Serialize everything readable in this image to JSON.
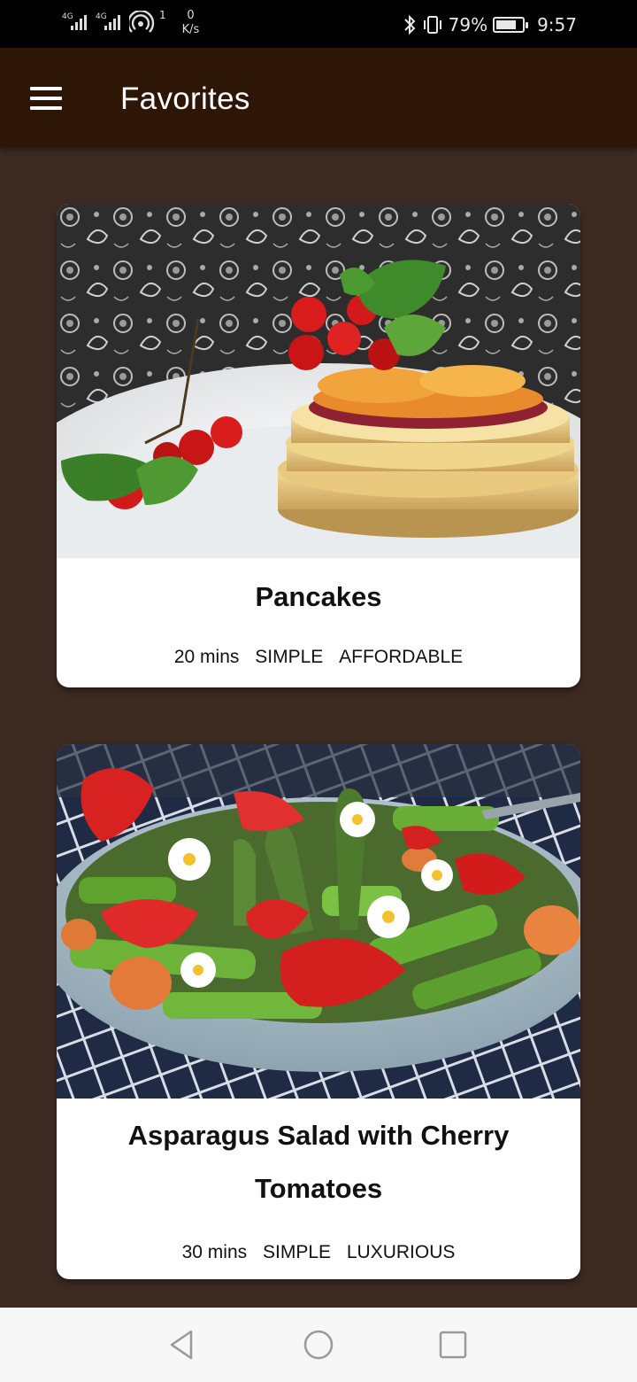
{
  "status_bar": {
    "network1": "4G",
    "network2": "4G",
    "wifi_sup": "1",
    "speed_value": "0",
    "speed_unit": "K/s",
    "battery_percent": "79%",
    "battery_level": 0.79,
    "time": "9:57"
  },
  "app_bar": {
    "title": "Favorites",
    "menu_icon": "hamburger-menu-icon"
  },
  "meals": [
    {
      "title": "Pancakes",
      "duration": "20 mins",
      "complexity": "SIMPLE",
      "affordability": "AFFORDABLE"
    },
    {
      "title": "Asparagus Salad with Cherry Tomatoes",
      "duration": "30 mins",
      "complexity": "SIMPLE",
      "affordability": "LUXURIOUS"
    }
  ],
  "nav_bar": {
    "back_icon": "triangle-back-icon",
    "home_icon": "circle-home-icon",
    "recents_icon": "square-recents-icon"
  },
  "colors": {
    "app_bar": "#2e1606",
    "background": "#3d2b22",
    "card": "#ffffff"
  }
}
